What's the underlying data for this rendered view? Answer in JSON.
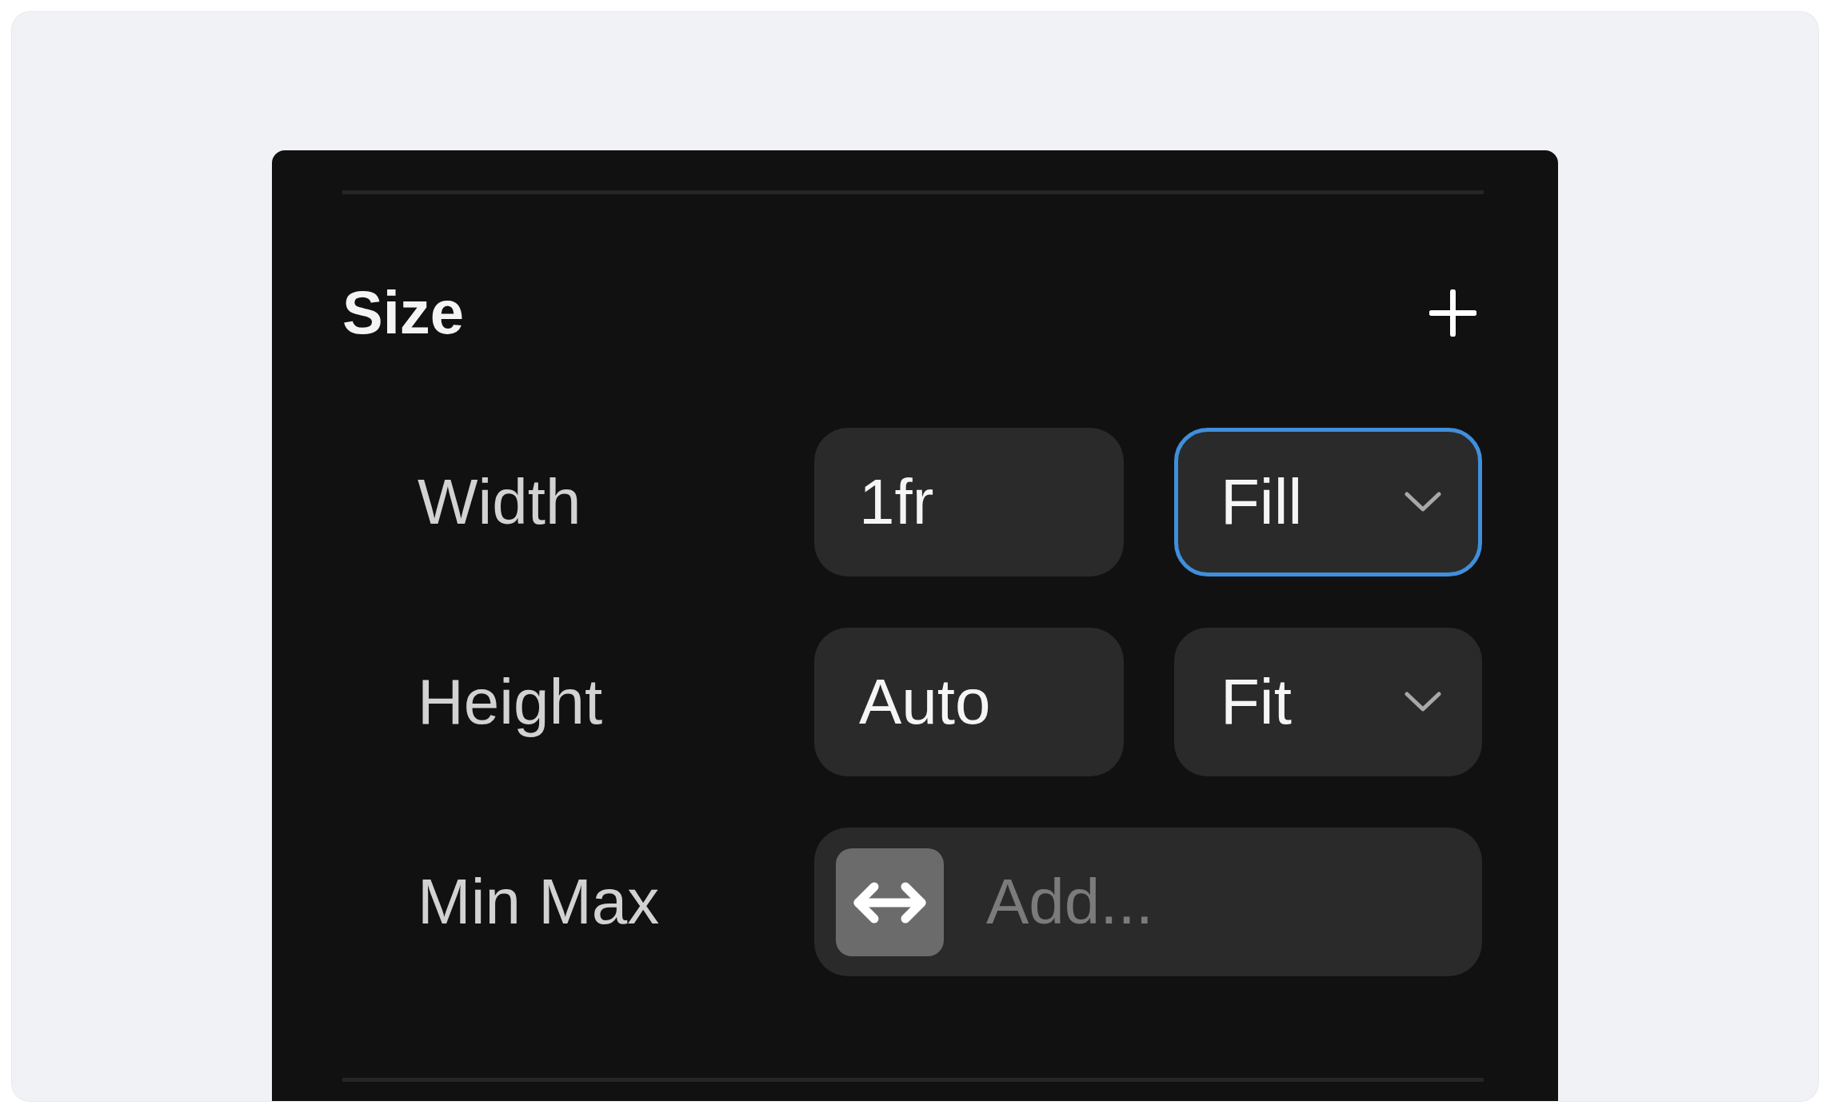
{
  "section": {
    "title": "Size"
  },
  "rows": [
    {
      "kind": "dimension",
      "label": "Width",
      "value": "1fr",
      "mode": {
        "value": "Fill",
        "focused": true
      }
    },
    {
      "kind": "dimension",
      "label": "Height",
      "value": "Auto",
      "mode": {
        "value": "Fit",
        "focused": false
      }
    },
    {
      "kind": "range",
      "label": "Min Max",
      "placeholder": "Add..."
    }
  ]
}
